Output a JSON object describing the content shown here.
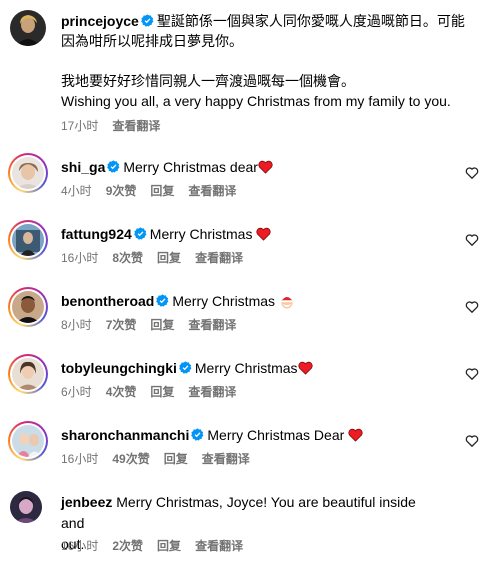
{
  "post": {
    "username": "princejoyce",
    "caption_line1": "聖誕節係一個與家人同你愛嘅人度過嘅節日。可能",
    "caption_line2": "因為咁所以呢排成日夢見你。",
    "caption_line3": "我地要好好珍惜同親人一齊渡過嘅每一個機會。",
    "caption_line4": "Wishing you all, a very happy Christmas from my family to you.",
    "time": "17小时",
    "translate": "查看翻译"
  },
  "comments": [
    {
      "username": "shi_ga",
      "text": "Merry Christmas dear",
      "emoji": "heart",
      "time": "4小时",
      "likes": "9次赞",
      "reply": "回复",
      "translate": "查看翻译"
    },
    {
      "username": "fattung924",
      "text": "Merry Christmas ",
      "emoji": "heart",
      "time": "16小时",
      "likes": "8次赞",
      "reply": "回复",
      "translate": "查看翻译"
    },
    {
      "username": "benontheroad",
      "text": "Merry Christmas ",
      "emoji": "santa",
      "time": "8小时",
      "likes": "7次赞",
      "reply": "回复",
      "translate": "查看翻译"
    },
    {
      "username": "tobyleungchingki",
      "text": "Merry Christmas",
      "emoji": "heart",
      "time": "6小时",
      "likes": "4次赞",
      "reply": "回复",
      "translate": "查看翻译"
    },
    {
      "username": "sharonchanmanchi",
      "text": "Merry Christmas Dear ",
      "emoji": "heart",
      "time": "16小时",
      "likes": "49次赞",
      "reply": "回复",
      "translate": "查看翻译"
    },
    {
      "username": "jenbeez",
      "text": "Merry Christmas, Joyce! You are beautiful inside and",
      "text2": "out.",
      "time": "16小时",
      "likes": "2次赞",
      "reply": "回复",
      "translate": "查看翻译"
    }
  ],
  "colors": {
    "meta": "#737373",
    "verified": "#0095f6",
    "heart": "#ed1c24"
  }
}
